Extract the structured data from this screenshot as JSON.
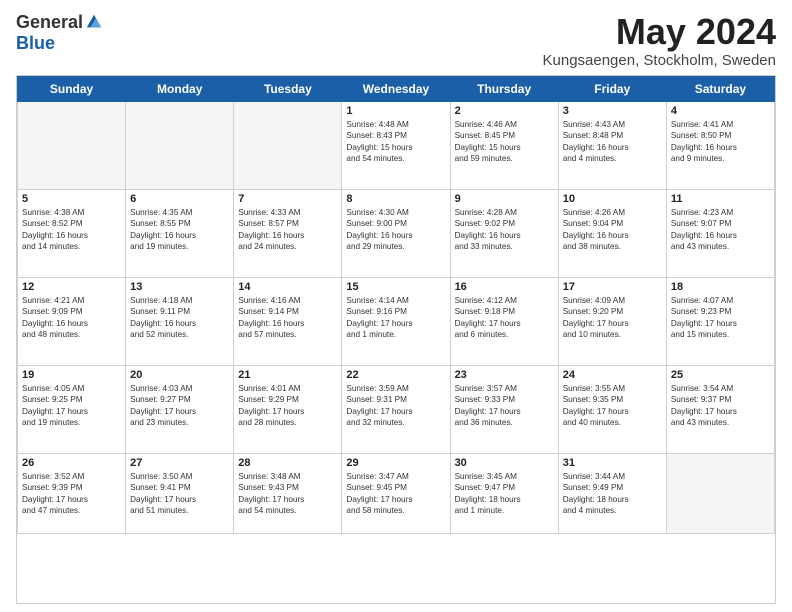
{
  "header": {
    "logo_general": "General",
    "logo_blue": "Blue",
    "month_title": "May 2024",
    "subtitle": "Kungsaengen, Stockholm, Sweden"
  },
  "days_of_week": [
    "Sunday",
    "Monday",
    "Tuesday",
    "Wednesday",
    "Thursday",
    "Friday",
    "Saturday"
  ],
  "weeks": [
    [
      {
        "day": "",
        "info": ""
      },
      {
        "day": "",
        "info": ""
      },
      {
        "day": "",
        "info": ""
      },
      {
        "day": "1",
        "info": "Sunrise: 4:48 AM\nSunset: 8:43 PM\nDaylight: 15 hours\nand 54 minutes."
      },
      {
        "day": "2",
        "info": "Sunrise: 4:46 AM\nSunset: 8:45 PM\nDaylight: 15 hours\nand 59 minutes."
      },
      {
        "day": "3",
        "info": "Sunrise: 4:43 AM\nSunset: 8:48 PM\nDaylight: 16 hours\nand 4 minutes."
      },
      {
        "day": "4",
        "info": "Sunrise: 4:41 AM\nSunset: 8:50 PM\nDaylight: 16 hours\nand 9 minutes."
      }
    ],
    [
      {
        "day": "5",
        "info": "Sunrise: 4:38 AM\nSunset: 8:52 PM\nDaylight: 16 hours\nand 14 minutes."
      },
      {
        "day": "6",
        "info": "Sunrise: 4:35 AM\nSunset: 8:55 PM\nDaylight: 16 hours\nand 19 minutes."
      },
      {
        "day": "7",
        "info": "Sunrise: 4:33 AM\nSunset: 8:57 PM\nDaylight: 16 hours\nand 24 minutes."
      },
      {
        "day": "8",
        "info": "Sunrise: 4:30 AM\nSunset: 9:00 PM\nDaylight: 16 hours\nand 29 minutes."
      },
      {
        "day": "9",
        "info": "Sunrise: 4:28 AM\nSunset: 9:02 PM\nDaylight: 16 hours\nand 33 minutes."
      },
      {
        "day": "10",
        "info": "Sunrise: 4:26 AM\nSunset: 9:04 PM\nDaylight: 16 hours\nand 38 minutes."
      },
      {
        "day": "11",
        "info": "Sunrise: 4:23 AM\nSunset: 9:07 PM\nDaylight: 16 hours\nand 43 minutes."
      }
    ],
    [
      {
        "day": "12",
        "info": "Sunrise: 4:21 AM\nSunset: 9:09 PM\nDaylight: 16 hours\nand 48 minutes."
      },
      {
        "day": "13",
        "info": "Sunrise: 4:18 AM\nSunset: 9:11 PM\nDaylight: 16 hours\nand 52 minutes."
      },
      {
        "day": "14",
        "info": "Sunrise: 4:16 AM\nSunset: 9:14 PM\nDaylight: 16 hours\nand 57 minutes."
      },
      {
        "day": "15",
        "info": "Sunrise: 4:14 AM\nSunset: 9:16 PM\nDaylight: 17 hours\nand 1 minute."
      },
      {
        "day": "16",
        "info": "Sunrise: 4:12 AM\nSunset: 9:18 PM\nDaylight: 17 hours\nand 6 minutes."
      },
      {
        "day": "17",
        "info": "Sunrise: 4:09 AM\nSunset: 9:20 PM\nDaylight: 17 hours\nand 10 minutes."
      },
      {
        "day": "18",
        "info": "Sunrise: 4:07 AM\nSunset: 9:23 PM\nDaylight: 17 hours\nand 15 minutes."
      }
    ],
    [
      {
        "day": "19",
        "info": "Sunrise: 4:05 AM\nSunset: 9:25 PM\nDaylight: 17 hours\nand 19 minutes."
      },
      {
        "day": "20",
        "info": "Sunrise: 4:03 AM\nSunset: 9:27 PM\nDaylight: 17 hours\nand 23 minutes."
      },
      {
        "day": "21",
        "info": "Sunrise: 4:01 AM\nSunset: 9:29 PM\nDaylight: 17 hours\nand 28 minutes."
      },
      {
        "day": "22",
        "info": "Sunrise: 3:59 AM\nSunset: 9:31 PM\nDaylight: 17 hours\nand 32 minutes."
      },
      {
        "day": "23",
        "info": "Sunrise: 3:57 AM\nSunset: 9:33 PM\nDaylight: 17 hours\nand 36 minutes."
      },
      {
        "day": "24",
        "info": "Sunrise: 3:55 AM\nSunset: 9:35 PM\nDaylight: 17 hours\nand 40 minutes."
      },
      {
        "day": "25",
        "info": "Sunrise: 3:54 AM\nSunset: 9:37 PM\nDaylight: 17 hours\nand 43 minutes."
      }
    ],
    [
      {
        "day": "26",
        "info": "Sunrise: 3:52 AM\nSunset: 9:39 PM\nDaylight: 17 hours\nand 47 minutes."
      },
      {
        "day": "27",
        "info": "Sunrise: 3:50 AM\nSunset: 9:41 PM\nDaylight: 17 hours\nand 51 minutes."
      },
      {
        "day": "28",
        "info": "Sunrise: 3:48 AM\nSunset: 9:43 PM\nDaylight: 17 hours\nand 54 minutes."
      },
      {
        "day": "29",
        "info": "Sunrise: 3:47 AM\nSunset: 9:45 PM\nDaylight: 17 hours\nand 58 minutes."
      },
      {
        "day": "30",
        "info": "Sunrise: 3:45 AM\nSunset: 9:47 PM\nDaylight: 18 hours\nand 1 minute."
      },
      {
        "day": "31",
        "info": "Sunrise: 3:44 AM\nSunset: 9:49 PM\nDaylight: 18 hours\nand 4 minutes."
      },
      {
        "day": "",
        "info": ""
      }
    ]
  ]
}
